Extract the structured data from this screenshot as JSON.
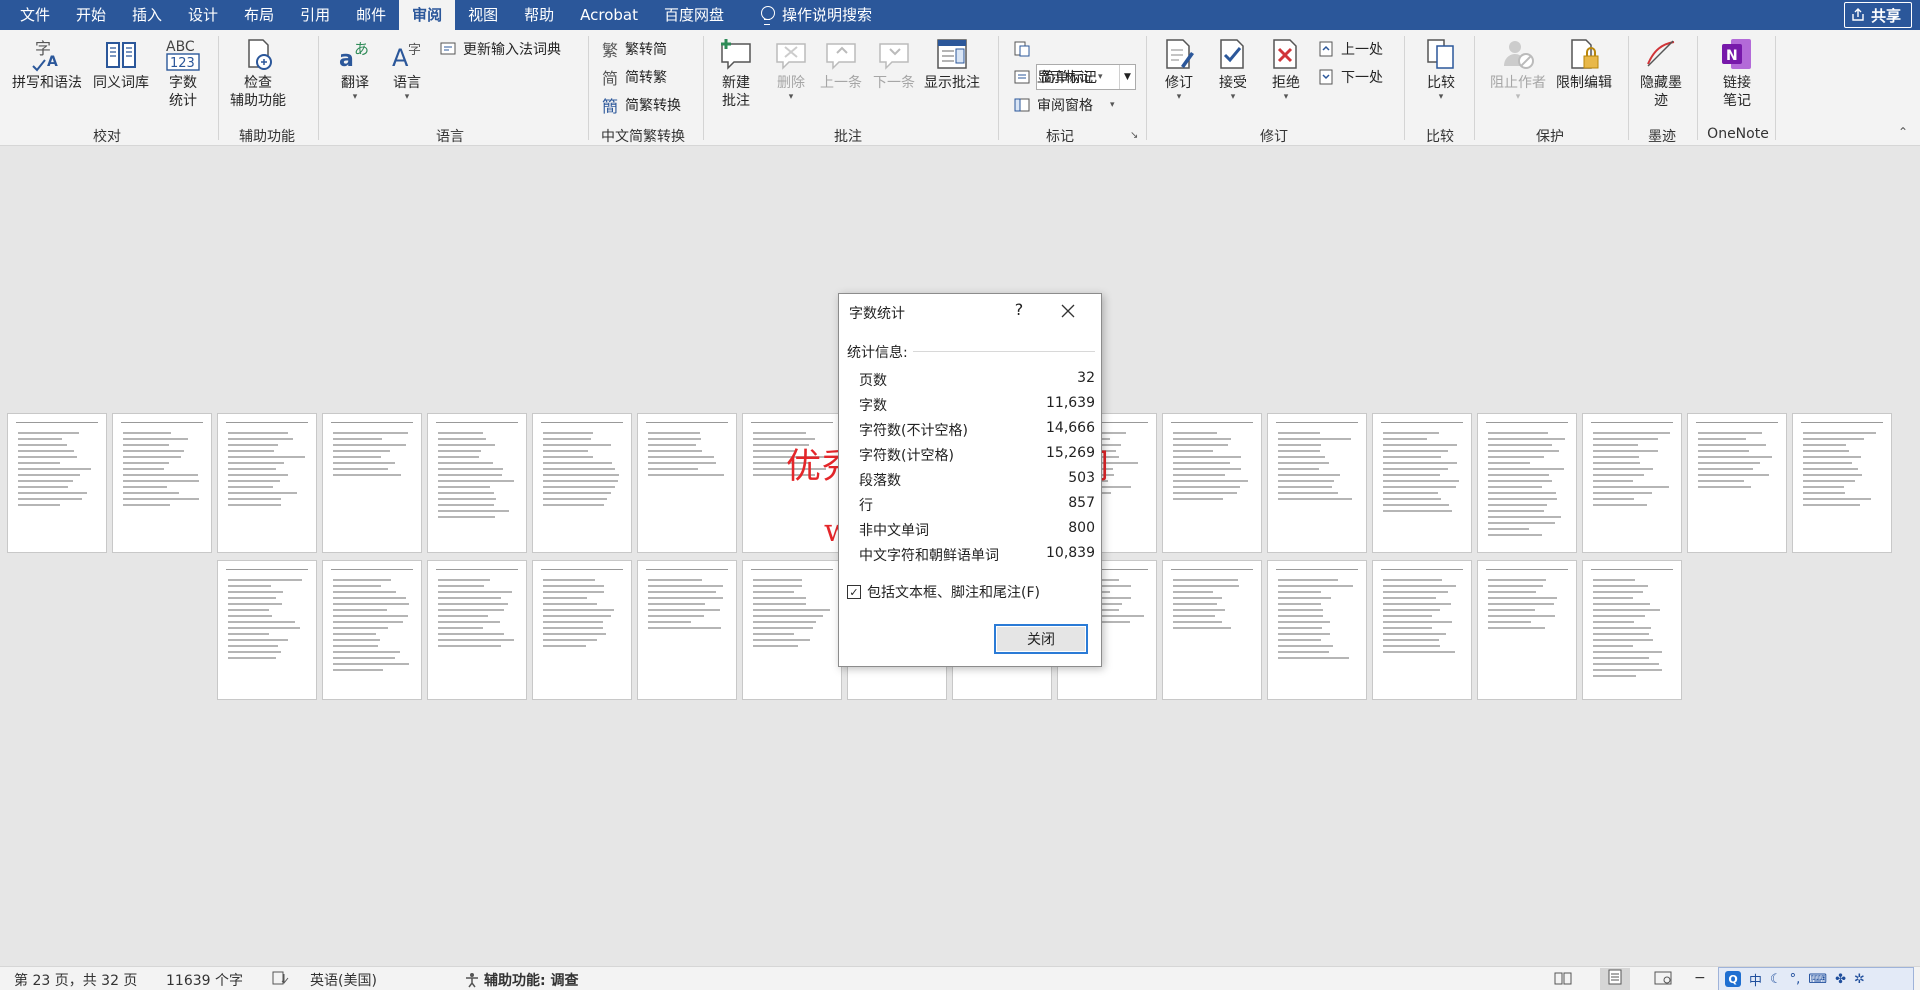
{
  "menubar": {
    "tabs": [
      "文件",
      "开始",
      "插入",
      "设计",
      "布局",
      "引用",
      "邮件",
      "审阅",
      "视图",
      "帮助",
      "Acrobat",
      "百度网盘"
    ],
    "active_tab": "审阅",
    "tell_me": "操作说明搜索",
    "share": "共享"
  },
  "ribbon": {
    "proofing": {
      "label": "校对",
      "spelling": "拼写和语法",
      "thesaurus": "同义词库",
      "wordcount_1": "字数",
      "wordcount_2": "统计"
    },
    "accessibility": {
      "label": "辅助功能",
      "check_1": "检查",
      "check_2": "辅助功能"
    },
    "language": {
      "label": "语言",
      "translate": "翻译",
      "language": "语言",
      "update_ime": "更新输入法词典"
    },
    "chinese_conversion": {
      "label": "中文简繁转换",
      "to_simplified": "繁转简",
      "to_traditional": "简转繁",
      "convert": "简繁转换"
    },
    "comments": {
      "label": "批注",
      "new_1": "新建",
      "new_2": "批注",
      "delete": "删除",
      "previous": "上一条",
      "next": "下一条",
      "show": "显示批注"
    },
    "tracking": {
      "label": "标记",
      "markup_mode": "简单标记",
      "show_markup": "显示标记",
      "review_pane": "审阅窗格"
    },
    "changes": {
      "label": "修订",
      "track": "修订",
      "accept": "接受",
      "reject": "拒绝",
      "previous": "上一处",
      "next": "下一处"
    },
    "compare": {
      "label": "比较",
      "compare": "比较"
    },
    "protect": {
      "label": "保护",
      "block_authors": "阻止作者",
      "restrict": "限制编辑"
    },
    "ink": {
      "label": "墨迹",
      "hide_1": "隐藏墨",
      "hide_2": "迹"
    },
    "onenote": {
      "label": "OneNote",
      "link_1": "链接",
      "link_2": "笔记"
    }
  },
  "document": {
    "total_pages": 32
  },
  "watermark": {
    "line1": "优秀毕业设计资源网",
    "line2": "www.keyicad.cn"
  },
  "dialog": {
    "title": "字数统计",
    "help": "?",
    "stats_header": "统计信息:",
    "rows": [
      {
        "label": "页数",
        "value": "32"
      },
      {
        "label": "字数",
        "value": "11,639"
      },
      {
        "label": "字符数(不计空格)",
        "value": "14,666"
      },
      {
        "label": "字符数(计空格)",
        "value": "15,269"
      },
      {
        "label": "段落数",
        "value": "503"
      },
      {
        "label": "行",
        "value": "857"
      },
      {
        "label": "非中文单词",
        "value": "800"
      },
      {
        "label": "中文字符和朝鲜语单词",
        "value": "10,839"
      }
    ],
    "include_textboxes": "包括文本框、脚注和尾注(F)",
    "include_checked": true,
    "close": "关闭"
  },
  "statusbar": {
    "page": "第 23 页，共 32 页",
    "words": "11639 个字",
    "language": "英语(美国)",
    "accessibility": "辅助功能: 调查"
  },
  "ime": {
    "mode": "中"
  }
}
